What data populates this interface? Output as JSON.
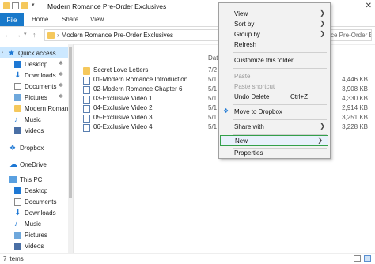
{
  "window": {
    "title": "Modern Romance Pre-Order Exclusives"
  },
  "ribbon": {
    "tabs": [
      "File",
      "Home",
      "Share",
      "View"
    ]
  },
  "address": {
    "path": "Modern Romance Pre-Order Exclusives",
    "search_placeholder": "ce Pre-Order Exclusives"
  },
  "nav": {
    "quick_access": "Quick access",
    "quick_items": [
      "Desktop",
      "Downloads",
      "Documents",
      "Pictures",
      "Modern Romanc",
      "Music",
      "Videos"
    ],
    "dropbox": "Dropbox",
    "onedrive": "OneDrive",
    "thispc": "This PC",
    "pc_items": [
      "Desktop",
      "Documents",
      "Downloads",
      "Music",
      "Pictures",
      "Videos"
    ]
  },
  "files": {
    "col_date": "Dat",
    "rows": [
      {
        "name": "Secret Love Letters",
        "date": "7/2",
        "size": "",
        "kind": "folder"
      },
      {
        "name": "01-Modern Romance Introduction",
        "date": "5/1",
        "size": "4,446 KB",
        "kind": "video"
      },
      {
        "name": "02-Modern Romance Chapter 6",
        "date": "5/1",
        "size": "3,908 KB",
        "kind": "video"
      },
      {
        "name": "03-Exclusive Video 1",
        "date": "5/1",
        "size": "4,330 KB",
        "kind": "video"
      },
      {
        "name": "04-Exclusive Video 2",
        "date": "5/1",
        "size": "2,914 KB",
        "kind": "video"
      },
      {
        "name": "05-Exclusive Video 3",
        "date": "5/1",
        "size": "3,251 KB",
        "kind": "video"
      },
      {
        "name": "06-Exclusive Video 4",
        "date": "5/1",
        "size": "3,228 KB",
        "kind": "video"
      }
    ]
  },
  "status": {
    "text": "7 items"
  },
  "context_menu": {
    "view": "View",
    "sort_by": "Sort by",
    "group_by": "Group by",
    "refresh": "Refresh",
    "customize": "Customize this folder...",
    "paste": "Paste",
    "paste_shortcut": "Paste shortcut",
    "undo_delete": "Undo Delete",
    "undo_shortcut": "Ctrl+Z",
    "move_dropbox": "Move to Dropbox",
    "share_with": "Share with",
    "new": "New",
    "properties": "Properties"
  }
}
